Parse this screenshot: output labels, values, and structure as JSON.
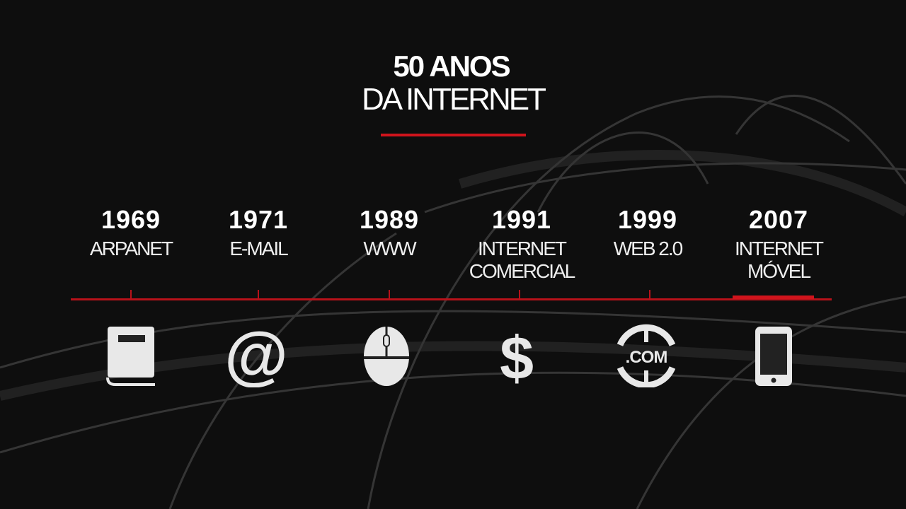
{
  "header": {
    "title_bold": "50 ANOS",
    "title_light": "DA INTERNET"
  },
  "accent_color": "#d0141c",
  "timeline": [
    {
      "year": "1969",
      "label": [
        "ARPANET"
      ],
      "icon": "book-icon"
    },
    {
      "year": "1971",
      "label": [
        "E-MAIL"
      ],
      "icon": "at-sign-icon"
    },
    {
      "year": "1989",
      "label": [
        "WWW"
      ],
      "icon": "mouse-icon"
    },
    {
      "year": "1991",
      "label": [
        "INTERNET",
        "COMERCIAL"
      ],
      "icon": "dollar-icon"
    },
    {
      "year": "1999",
      "label": [
        "WEB 2.0"
      ],
      "icon": "globe-com-icon",
      "icon_text": ".COM"
    },
    {
      "year": "2007",
      "label": [
        "INTERNET",
        "MÓVEL"
      ],
      "icon": "smartphone-icon",
      "active": true
    }
  ]
}
